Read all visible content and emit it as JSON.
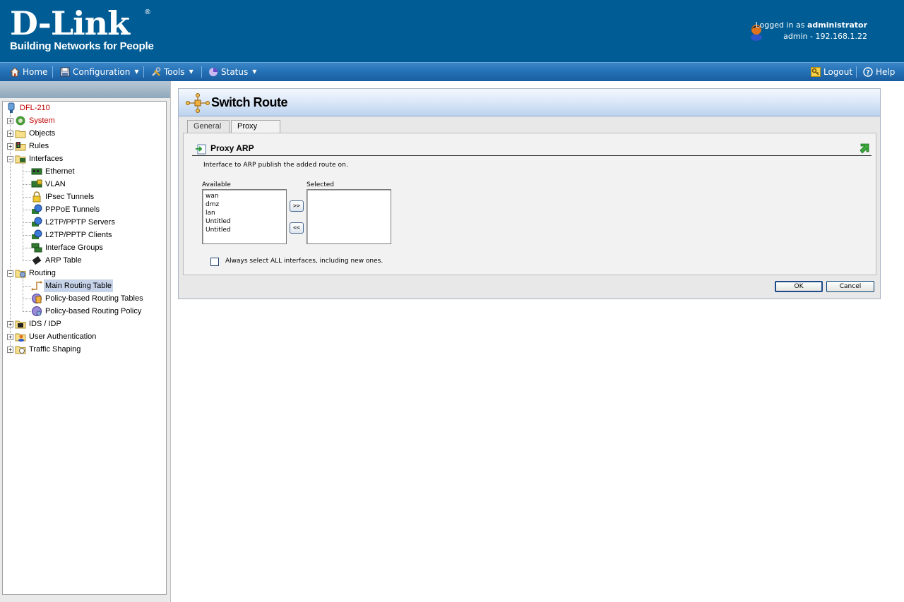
{
  "header": {
    "brand": "D-Link",
    "registered_mark": "®",
    "tagline": "Building Networks for People",
    "logged_in_prefix": "Logged in as ",
    "logged_in_user": "administrator",
    "session_info": "admin - 192.168.1.22"
  },
  "menu": {
    "home": "Home",
    "configuration": "Configuration",
    "tools": "Tools",
    "status": "Status",
    "logout": "Logout",
    "help": "Help"
  },
  "tree": {
    "root": "DFL-210",
    "items": [
      {
        "label": "System",
        "expander": "+"
      },
      {
        "label": "Objects",
        "expander": "+"
      },
      {
        "label": "Rules",
        "expander": "+"
      },
      {
        "label": "Interfaces",
        "expander": "−"
      },
      {
        "label": "Ethernet"
      },
      {
        "label": "VLAN"
      },
      {
        "label": "IPsec Tunnels"
      },
      {
        "label": "PPPoE Tunnels"
      },
      {
        "label": "L2TP/PPTP Servers"
      },
      {
        "label": "L2TP/PPTP Clients"
      },
      {
        "label": "Interface Groups"
      },
      {
        "label": "ARP Table"
      },
      {
        "label": "Routing",
        "expander": "−"
      },
      {
        "label": "Main Routing Table"
      },
      {
        "label": "Policy-based Routing Tables"
      },
      {
        "label": "Policy-based Routing Policy"
      },
      {
        "label": "IDS / IDP",
        "expander": "+"
      },
      {
        "label": "User Authentication",
        "expander": "+"
      },
      {
        "label": "Traffic Shaping",
        "expander": "+"
      }
    ]
  },
  "page": {
    "title": "Switch Route",
    "tabs": [
      "General",
      "Proxy ARP"
    ],
    "active_tab": "Proxy ARP",
    "section_title": "Proxy ARP",
    "description": "Interface to ARP publish the added route on.",
    "available_label": "Available",
    "selected_label": "Selected",
    "available_items": [
      "wan",
      "dmz",
      "lan",
      "Untitled",
      "Untitled"
    ],
    "selected_items": [],
    "add_button": ">>",
    "remove_button": "<<",
    "checkbox_label": "Always select ALL interfaces, including new ones.",
    "checkbox_checked": false,
    "ok_button": "OK",
    "cancel_button": "Cancel"
  },
  "colors": {
    "header_bg": "#005c94",
    "menubar_bg": "#2470b5",
    "selected_item_bg": "#c6d3e8",
    "red_text": "#c00000"
  }
}
